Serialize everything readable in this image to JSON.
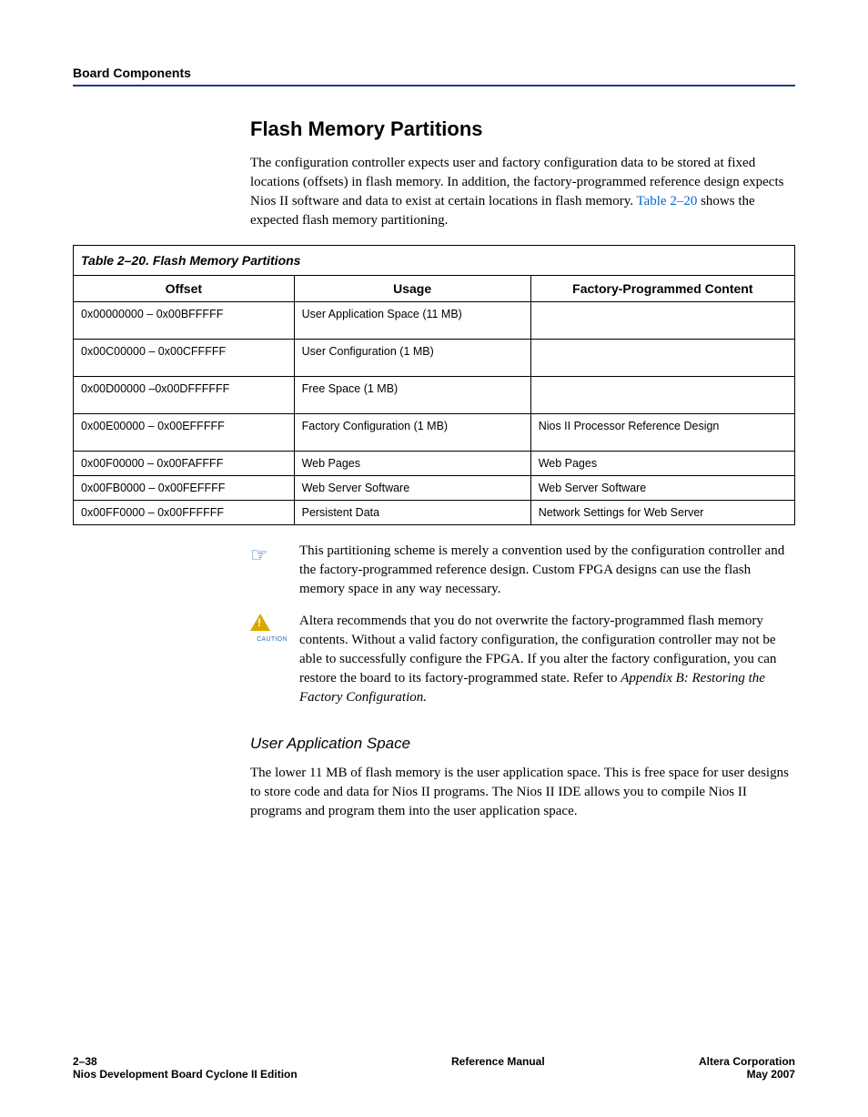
{
  "header": {
    "section": "Board Components"
  },
  "section": {
    "title": "Flash Memory Partitions",
    "intro": "The configuration controller expects user and factory configuration data to be stored at fixed locations (offsets) in flash memory. In addition, the factory-programmed reference design expects Nios II software and data to exist at certain locations in flash memory. ",
    "intro_link": "Table 2–20",
    "intro_post": " shows the expected flash memory partitioning."
  },
  "table": {
    "caption": "Table 2–20. Flash Memory Partitions",
    "headers": [
      "Offset",
      "Usage",
      "Factory-Programmed Content"
    ],
    "rows": [
      {
        "offset": "0x00000000 – 0x00BFFFFF",
        "usage": "User Application Space (11 MB)",
        "content": ""
      },
      {
        "offset": "0x00C00000 – 0x00CFFFFF",
        "usage": "User Configuration (1 MB)",
        "content": ""
      },
      {
        "offset": "0x00D00000 –0x00DFFFFFF",
        "usage": "Free Space (1 MB)",
        "content": ""
      },
      {
        "offset": "0x00E00000 – 0x00EFFFFF",
        "usage": "Factory Configuration (1 MB)",
        "content": "Nios II Processor Reference Design"
      },
      {
        "offset": "0x00F00000 – 0x00FAFFFF",
        "usage": "Web Pages",
        "content": "Web Pages"
      },
      {
        "offset": "0x00FB0000 – 0x00FEFFFF",
        "usage": "Web Server Software",
        "content": "Web Server Software"
      },
      {
        "offset": "0x00FF0000 – 0x00FFFFFF",
        "usage": "Persistent Data",
        "content": "Network Settings for Web Server"
      }
    ]
  },
  "note1": "This partitioning scheme is merely a convention used by the configuration controller and the factory-programmed reference design. Custom FPGA designs can use the flash memory space in any way necessary.",
  "caution": {
    "pre": "Altera recommends that you do not overwrite the factory-programmed flash memory contents. Without a valid factory configuration, the configuration controller may not be able to successfully configure the FPGA. If you alter the factory configuration, you can restore the board to its factory-programmed state. Refer to ",
    "italic": "Appendix B: Restoring the Factory Configuration."
  },
  "subsection": {
    "title": "User Application Space",
    "body": "The lower 11 MB of flash memory is the user application space. This is free space for user designs to store code and data for Nios II programs. The Nios II IDE allows you to compile Nios II programs and program them into the user application space."
  },
  "footer": {
    "left_line1": "2–38",
    "left_line2": "Nios Development Board Cyclone II Edition",
    "center": "Reference Manual",
    "right_line1": "Altera Corporation",
    "right_line2": "May 2007"
  },
  "chart_data": {
    "type": "table",
    "title": "Table 2–20. Flash Memory Partitions",
    "columns": [
      "Offset",
      "Usage",
      "Factory-Programmed Content"
    ],
    "rows": [
      [
        "0x00000000 – 0x00BFFFFF",
        "User Application Space (11 MB)",
        ""
      ],
      [
        "0x00C00000 – 0x00CFFFFF",
        "User Configuration (1 MB)",
        ""
      ],
      [
        "0x00D00000 –0x00DFFFFFF",
        "Free Space (1 MB)",
        ""
      ],
      [
        "0x00E00000 – 0x00EFFFFF",
        "Factory Configuration (1 MB)",
        "Nios II Processor Reference Design"
      ],
      [
        "0x00F00000 – 0x00FAFFFF",
        "Web Pages",
        "Web Pages"
      ],
      [
        "0x00FB0000 – 0x00FEFFFF",
        "Web Server Software",
        "Web Server Software"
      ],
      [
        "0x00FF0000 – 0x00FFFFFF",
        "Persistent Data",
        "Network Settings for Web Server"
      ]
    ]
  }
}
